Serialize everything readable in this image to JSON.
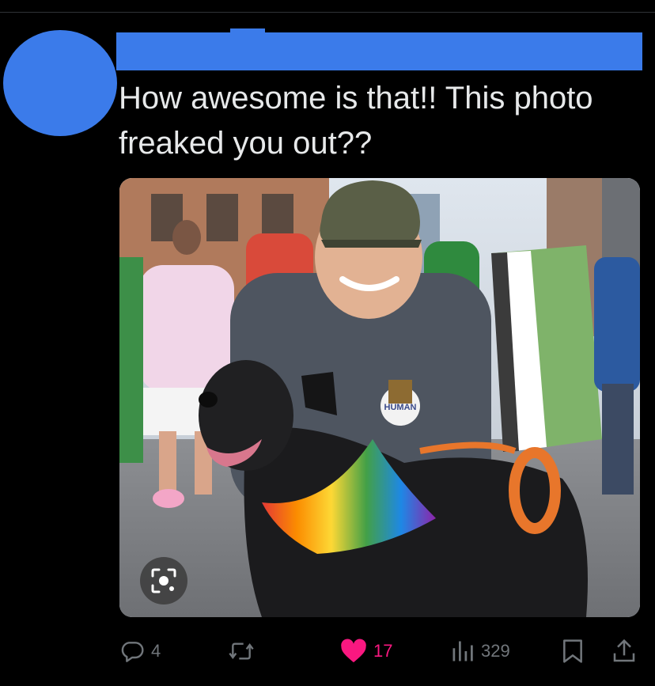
{
  "tweet": {
    "text": "How awesome is that!! This photo freaked you out??",
    "image_badges": {
      "button_text": "HUMAN"
    }
  },
  "actions": {
    "replies": "4",
    "likes": "17",
    "views": "329"
  },
  "colors": {
    "redaction": "#3b7bea",
    "like": "#f91880",
    "icon_gray": "#71767b"
  },
  "icons": [
    "reply-icon",
    "retweet-icon",
    "heart-icon",
    "views-icon",
    "bookmark-icon",
    "share-icon",
    "lens-icon"
  ]
}
